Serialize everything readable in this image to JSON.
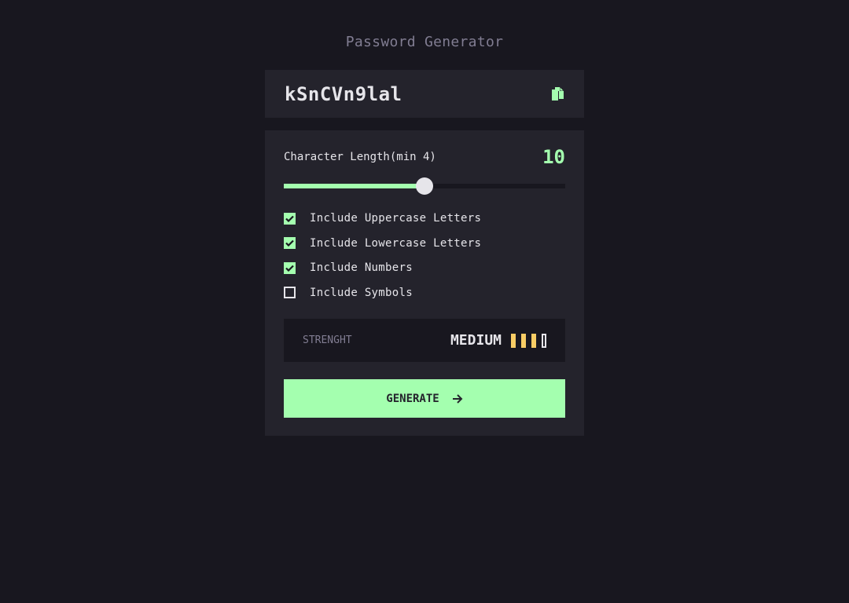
{
  "app": {
    "title": "Password Generator"
  },
  "output": {
    "password": "kSnCVn9lal",
    "copy_icon": "copy-icon"
  },
  "length": {
    "label": "Character Length(min 4)",
    "value": "10",
    "slider_fraction": 0.5
  },
  "options": [
    {
      "label": "Include Uppercase Letters",
      "checked": true
    },
    {
      "label": "Include Lowercase Letters",
      "checked": true
    },
    {
      "label": "Include Numbers",
      "checked": true
    },
    {
      "label": "Include Symbols",
      "checked": false
    }
  ],
  "strength": {
    "label": "STRENGHT",
    "value": "MEDIUM",
    "bars_filled": 3,
    "bars_total": 4
  },
  "generate": {
    "label": "GENERATE",
    "icon": "arrow-right-icon"
  },
  "colors": {
    "accent": "#A4FFAF",
    "strength_medium": "#F8CD65",
    "background": "#18171F",
    "panel": "#24232C"
  }
}
